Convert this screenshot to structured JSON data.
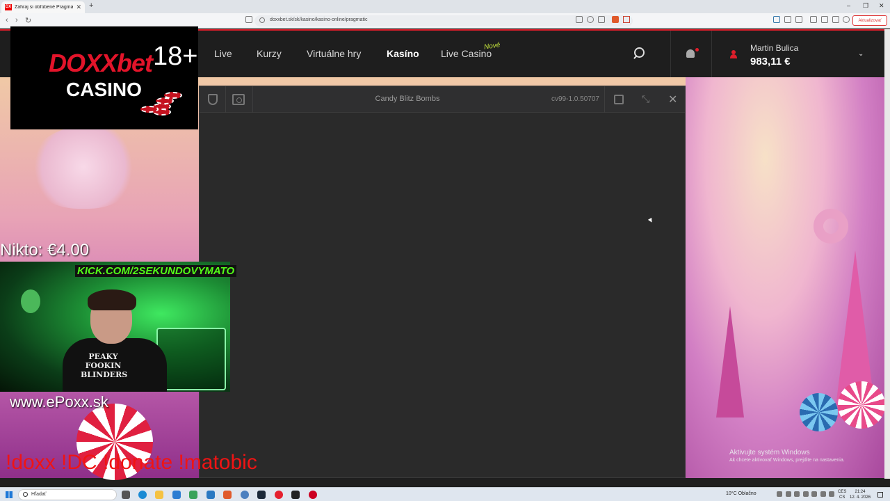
{
  "browser": {
    "tab_label": "Zahraj si obľúbené Pragmatic hry",
    "tab_favicon": "DX",
    "new_tab": "+",
    "url": "doxxbet.sk/sk/kasino/kasino-online/pragmatic",
    "update_button": "Aktualizovať",
    "back_icon": "‹",
    "forward_icon": "›",
    "reload_icon": "↻",
    "minimize": "–",
    "maximize": "❐",
    "close": "✕"
  },
  "header": {
    "nav": [
      {
        "label": "Live"
      },
      {
        "label": "Kurzy"
      },
      {
        "label": "Virtuálne hry"
      },
      {
        "label": "Kasíno"
      },
      {
        "label": "Live Casino"
      }
    ],
    "new_badge": "Nové",
    "user_name": "Martin Bulica",
    "balance": "983,11 €",
    "chevron": "⌄"
  },
  "game": {
    "title": "Candy Blitz Bombs",
    "version": "cv99-1.0.50707",
    "close_icon": "✕",
    "shrink_icon": "⤡"
  },
  "overlay": {
    "logo_brand": "DOXXbet",
    "logo_age": "18+",
    "logo_casino": "CASINO",
    "nikto": "Nikto: €4.00",
    "kick": "KICK.COM/2SEKUNDOVYMATO",
    "shirt_text": "PEAKY FOOKIN BLINDERS",
    "epoxx": "www.ePoxx.sk",
    "commands": "!doxx !DC !donate !matobic"
  },
  "windows": {
    "activate_title": "Aktivujte systém Windows",
    "activate_sub": "Ak chcete aktivovať Windows, prejdite na nastavenia.",
    "search_placeholder": "Hľadať",
    "weather": "10°C  Oblačno",
    "lang_top": "CES",
    "lang_bottom": "CS",
    "time": "21:24",
    "date": "12. 4. 2026"
  },
  "colors": {
    "accent": "#e01e2b",
    "kick_green": "#53fc18",
    "new_badge": "#c8e83c"
  }
}
